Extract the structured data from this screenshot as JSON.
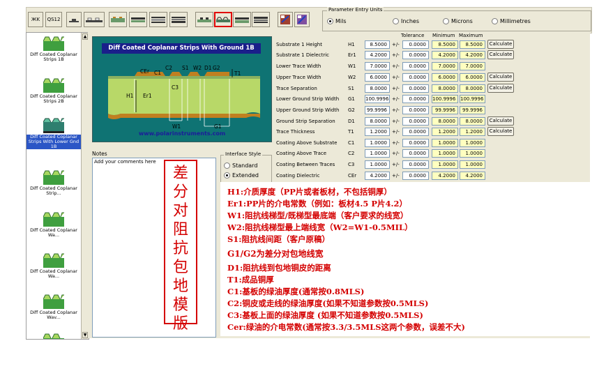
{
  "toolbar": {
    "btn1": "ЖK",
    "btn2": "QS12",
    "units_title": "Parameter Entry Units",
    "units": [
      {
        "label": "Mils",
        "selected": true
      },
      {
        "label": "Inches",
        "selected": false
      },
      {
        "label": "Microns",
        "selected": false
      },
      {
        "label": "Millimetres",
        "selected": false
      }
    ]
  },
  "structures": [
    {
      "caption": "Diff Coated Coplanar Strips 1B",
      "selected": false
    },
    {
      "caption": "Diff Coated Coplanar Strips 2B",
      "selected": false
    },
    {
      "caption": "Diff Coated Coplanar Strips With Lower Gnd 1B",
      "selected": true
    },
    {
      "caption": "Diff Coated Coplanar Strip...",
      "selected": false
    },
    {
      "caption": "Diff Coated Coplanar Wa...",
      "selected": false
    },
    {
      "caption": "Diff Coated Coplanar Wa...",
      "selected": false
    },
    {
      "caption": "Diff Coated Coplanar Wav...",
      "selected": false
    }
  ],
  "diagram": {
    "title": "Diff Coated Coplanar Strips With Ground  1B",
    "website": "www.polarinstruments.com",
    "labels": {
      "cer": "CEr",
      "c1": "C1",
      "c2": "C2",
      "s1": "S1",
      "w2": "W2",
      "d1": "D1",
      "g2": "G2",
      "t1": "T1",
      "h1": "H1",
      "er1": "Er1",
      "c3": "C3",
      "w1": "W1",
      "g1": "G1"
    }
  },
  "notes": {
    "label": "Notes",
    "placeholder": "Add your comments here"
  },
  "interface_style": {
    "title": "Interface Style",
    "options": [
      {
        "label": "Standard",
        "selected": false
      },
      {
        "label": "Extended",
        "selected": true
      }
    ]
  },
  "columns": {
    "tolerance": "Tolerance",
    "minimum": "Minimum",
    "maximum": "Maximum"
  },
  "params": [
    {
      "name": "Substrate 1 Height",
      "sym": "H1",
      "value": "8.5000",
      "tol": "0.0000",
      "min": "8.5000",
      "max": "8.5000",
      "calc": "Calculate"
    },
    {
      "name": "Substrate 1 Dielectric",
      "sym": "Er1",
      "value": "4.2000",
      "tol": "0.0000",
      "min": "4.2000",
      "max": "4.2000",
      "calc": "Calculate"
    },
    {
      "name": "Lower Trace Width",
      "sym": "W1",
      "value": "7.0000",
      "tol": "0.0000",
      "min": "7.0000",
      "max": "7.0000",
      "calc": ""
    },
    {
      "name": "Upper Trace Width",
      "sym": "W2",
      "value": "6.0000",
      "tol": "0.0000",
      "min": "6.0000",
      "max": "6.0000",
      "calc": "Calculate"
    },
    {
      "name": "Trace Separation",
      "sym": "S1",
      "value": "8.0000",
      "tol": "0.0000",
      "min": "8.0000",
      "max": "8.0000",
      "calc": "Calculate"
    },
    {
      "name": "Lower Ground Strip Width",
      "sym": "G1",
      "value": "100.9996",
      "tol": "0.0000",
      "min": "100.9996",
      "max": "100.9996",
      "calc": ""
    },
    {
      "name": "Upper Ground Strip Width",
      "sym": "G2",
      "value": "99.9996",
      "tol": "0.0000",
      "min": "99.9996",
      "max": "99.9996",
      "calc": ""
    },
    {
      "name": "Ground Strip Separation",
      "sym": "D1",
      "value": "8.0000",
      "tol": "0.0000",
      "min": "8.0000",
      "max": "8.0000",
      "calc": "Calculate"
    },
    {
      "name": "Trace Thickness",
      "sym": "T1",
      "value": "1.2000",
      "tol": "0.0000",
      "min": "1.2000",
      "max": "1.2000",
      "calc": "Calculate"
    },
    {
      "name": "Coating Above Substrate",
      "sym": "C1",
      "value": "1.0000",
      "tol": "0.0000",
      "min": "1.0000",
      "max": "1.0000",
      "calc": ""
    },
    {
      "name": "Coating Above Trace",
      "sym": "C2",
      "value": "1.0000",
      "tol": "0.0000",
      "min": "1.0000",
      "max": "1.0000",
      "calc": ""
    },
    {
      "name": "Coating Between Traces",
      "sym": "C3",
      "value": "1.0000",
      "tol": "0.0000",
      "min": "1.0000",
      "max": "1.0000",
      "calc": ""
    },
    {
      "name": "Coating Dielectric",
      "sym": "CEr",
      "value": "4.2000",
      "tol": "0.0000",
      "min": "4.2000",
      "max": "4.2000",
      "calc": ""
    }
  ],
  "red_label": [
    "差",
    "分",
    "对",
    "阻",
    "抗",
    "包",
    "地",
    "模",
    "版"
  ],
  "annotations": [
    "H1:介质厚度（PP片或者板材，不包括铜厚）",
    "Er1:PP片的介电常数（例如：板材4.5  P片4.2）",
    "W1:阻抗线梯型/既梯型最底端（客户要求的线宽）",
    "W2:阻抗线梯型最上端线宽（W2=W1-0.5MIL）",
    "S1:阻抗线间距（客户原稿）",
    "G1/G2为差分对包地线宽",
    "D1:阻抗线到包地铜皮的距离",
    "T1:成品铜厚",
    "C1:基板的绿油厚度(通常按0.8MLS)",
    "C2:铜皮或走线的绿油厚度(如果不知道参数按0.5MLS)",
    "C3:基板上面的绿油厚度  (如果不知道参数按0.5MLS)",
    "Cer:绿油的介电常数(通常按3.3/3.5MLS这两个参数，误差不大)"
  ],
  "colors": {
    "accent_red": "#d40000",
    "panel_bg": "#ece9d8",
    "diagram_bg": "#0f7373",
    "title_bar": "#1a1f8a",
    "highlight_field": "#ffffc0",
    "selection": "#2b56c6"
  }
}
